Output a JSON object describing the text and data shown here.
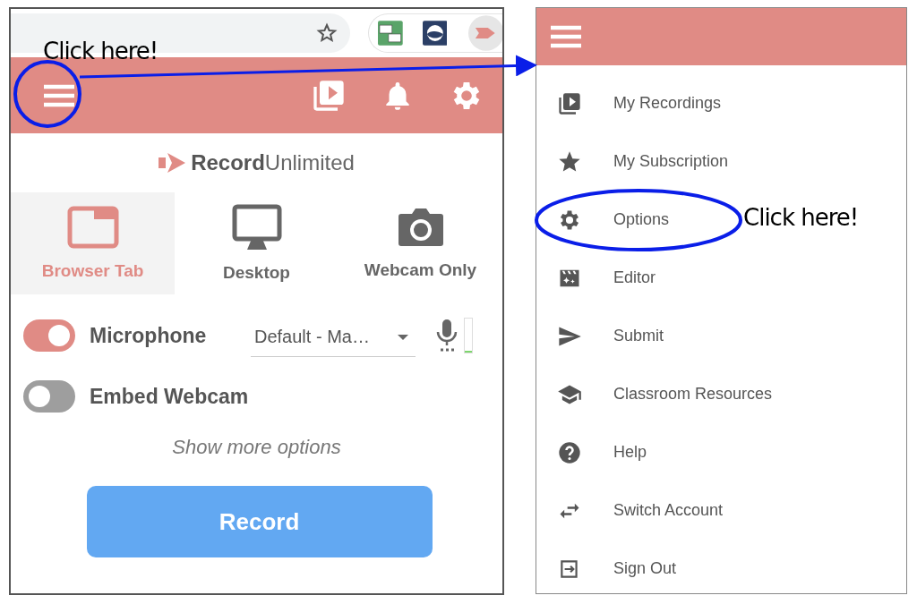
{
  "annotations": [
    {
      "text": "Click here!"
    },
    {
      "text": "Click here!"
    }
  ],
  "popup": {
    "logo": {
      "bold": "Record",
      "light": "Unlimited"
    },
    "modes": [
      {
        "kind": "browser",
        "label": "Browser Tab",
        "selected": true
      },
      {
        "kind": "desktop",
        "label": "Desktop",
        "selected": false
      },
      {
        "kind": "webcam",
        "label": "Webcam Only",
        "selected": false
      }
    ],
    "toggles": [
      {
        "label": "Microphone",
        "on": true,
        "device": "Default - Ma…",
        "level": 0.05
      },
      {
        "label": "Embed Webcam",
        "on": false
      }
    ],
    "more_options": "Show more options",
    "record_button": "Record"
  },
  "menu": {
    "items": [
      {
        "kind": "recordings",
        "label": "My Recordings"
      },
      {
        "kind": "star",
        "label": "My Subscription"
      },
      {
        "kind": "gear",
        "label": "Options"
      },
      {
        "kind": "editor",
        "label": "Editor"
      },
      {
        "kind": "send",
        "label": "Submit"
      },
      {
        "kind": "school",
        "label": "Classroom Resources"
      },
      {
        "kind": "help",
        "label": "Help"
      },
      {
        "kind": "switch",
        "label": "Switch Account"
      },
      {
        "kind": "signout",
        "label": "Sign Out"
      }
    ]
  }
}
